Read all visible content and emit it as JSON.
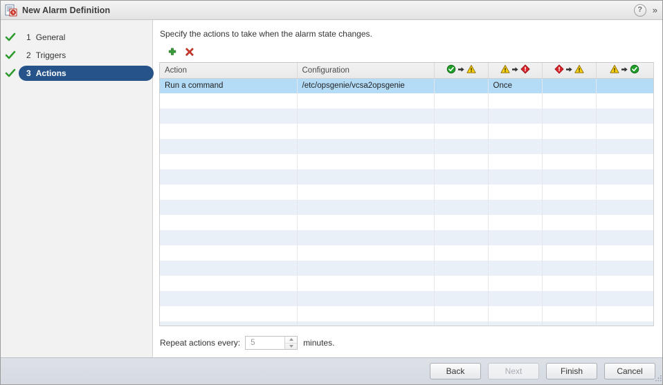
{
  "window": {
    "title": "New Alarm Definition",
    "icon": "alarm-definition-icon",
    "help_label": "?",
    "collapse_label": "»"
  },
  "sidebar": {
    "items": [
      {
        "num": "1",
        "label": "General",
        "completed": true,
        "active": false
      },
      {
        "num": "2",
        "label": "Triggers",
        "completed": true,
        "active": false
      },
      {
        "num": "3",
        "label": "Actions",
        "completed": true,
        "active": true
      }
    ],
    "active_pill_color": "#26548a",
    "check_color": "#2e9b2e"
  },
  "main": {
    "instruction": "Specify the actions to take when the alarm state changes.",
    "toolbar": {
      "add_label": "+",
      "add_icon": "green-plus-icon",
      "delete_label": "×",
      "delete_icon": "red-x-icon",
      "add_color": "#3a9c3a",
      "delete_color": "#d4392f"
    },
    "table": {
      "columns": [
        {
          "key": "action",
          "label": "Action",
          "type": "text",
          "width": 198
        },
        {
          "key": "configuration",
          "label": "Configuration",
          "type": "text",
          "width": 198
        },
        {
          "key": "normal_to_warning",
          "label": "",
          "type": "transition",
          "from": "normal",
          "to": "warning",
          "width": 78
        },
        {
          "key": "warning_to_alert",
          "label": "",
          "type": "transition",
          "from": "warning",
          "to": "alert",
          "width": 78
        },
        {
          "key": "alert_to_warning",
          "label": "",
          "type": "transition",
          "from": "alert",
          "to": "warning",
          "width": 78
        },
        {
          "key": "warning_to_normal",
          "label": "",
          "type": "transition",
          "from": "warning",
          "to": "normal",
          "width": 81
        }
      ],
      "rows": [
        {
          "selected": true,
          "action": "Run a command",
          "configuration": "/etc/opsgenie/vcsa2opsgenie",
          "normal_to_warning": "",
          "warning_to_alert": "Once",
          "alert_to_warning": "",
          "warning_to_normal": ""
        }
      ],
      "empty_row_count": 16,
      "selected_row_color": "#b5dcf7",
      "alt_row_color": "#eaf0f7"
    },
    "repeat": {
      "label": "Repeat actions every:",
      "value": "5",
      "placeholder": "5",
      "unit": "minutes."
    }
  },
  "footer": {
    "buttons": [
      {
        "label": "Back",
        "disabled": false,
        "name": "back-button"
      },
      {
        "label": "Next",
        "disabled": true,
        "name": "next-button"
      },
      {
        "label": "Finish",
        "disabled": false,
        "name": "finish-button"
      },
      {
        "label": "Cancel",
        "disabled": false,
        "name": "cancel-button"
      }
    ]
  }
}
